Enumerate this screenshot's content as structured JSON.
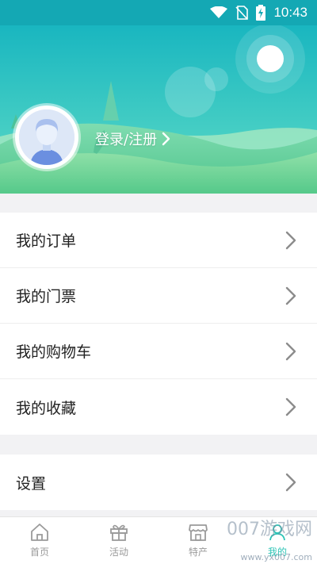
{
  "status_bar": {
    "time": "10:43"
  },
  "header": {
    "login_text": "登录/注册"
  },
  "menu": {
    "items": [
      {
        "label": "我的订单"
      },
      {
        "label": "我的门票"
      },
      {
        "label": "我的购物车"
      },
      {
        "label": "我的收藏"
      }
    ],
    "settings": {
      "label": "设置"
    }
  },
  "tabs": [
    {
      "label": "首页",
      "icon": "home-icon"
    },
    {
      "label": "活动",
      "icon": "gift-icon"
    },
    {
      "label": "特产",
      "icon": "shop-icon"
    },
    {
      "label": "我的",
      "icon": "user-icon"
    }
  ],
  "watermark": {
    "text": "007游戏网",
    "url": "www.yx007.com"
  },
  "colors": {
    "status_bar": "#14a8b4",
    "accent": "#2ec4b6",
    "hill": "#6ed39a"
  }
}
